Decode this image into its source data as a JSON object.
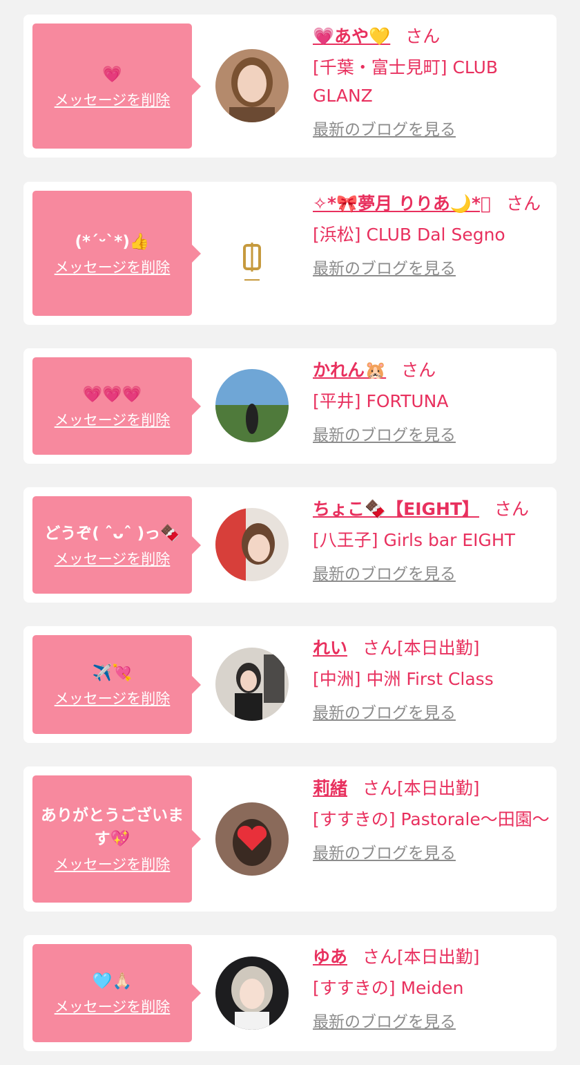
{
  "delete_label": "メッセージを削除",
  "blog_label": "最新のブログを見る",
  "honorific": "さん",
  "entries": [
    {
      "message": "💗",
      "name": "💗あや💛",
      "status": "",
      "shop": "[千葉・富士見町] CLUB GLANZ",
      "avatar": "woman-portrait-avatar"
    },
    {
      "message": "(*ˊᵕˋ*)👍",
      "name": "✧*🎀夢月 りりあ🌙*ﾟ",
      "status": "",
      "shop": "[浜松] CLUB Dal Segno",
      "avatar": "club-logo-avatar"
    },
    {
      "message": "💗💗💗",
      "name": "かれん🐹",
      "status": "",
      "shop": "[平井] FORTUNA",
      "avatar": "landscape-photo-avatar"
    },
    {
      "message": "どうぞ( ˆᴗˆ )っ🍫",
      "name": "ちょこ🍫【EIGHT】",
      "status": "",
      "shop": "[八王子] Girls bar EIGHT",
      "avatar": "woman-portrait-avatar"
    },
    {
      "message": "✈️💘",
      "name": "れい",
      "status": "[本日出勤]",
      "shop": "[中洲] 中洲 First Class",
      "avatar": "woman-portrait-avatar"
    },
    {
      "message": "ありがとうございます💖",
      "name": "莉緒",
      "status": "[本日出勤]",
      "shop": "[すすきの] Pastorale〜田園〜",
      "avatar": "woman-heart-avatar"
    },
    {
      "message": "🩵🙏🏻",
      "name": "ゆあ",
      "status": "[本日出勤]",
      "shop": "[すすきの] Meiden",
      "avatar": "woman-portrait-avatar"
    }
  ],
  "colors": {
    "accent": "#e8305e",
    "bubble": "#f7899e",
    "muted": "#8c8c8c",
    "background": "#f2f2f2"
  }
}
